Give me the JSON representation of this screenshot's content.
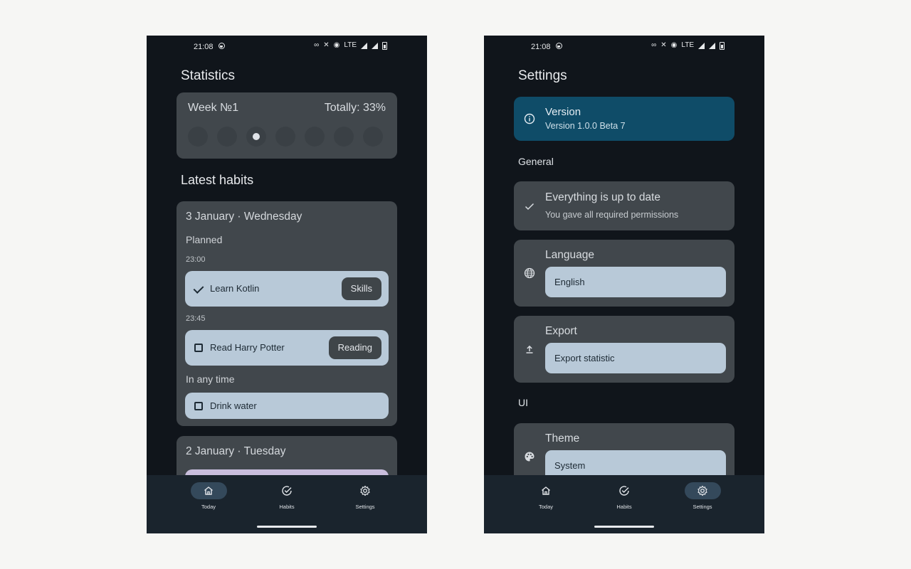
{
  "left": {
    "status": {
      "time": "21:08",
      "network": "LTE"
    },
    "title": "Statistics",
    "stats": {
      "week": "Week №1",
      "total": "Totally: 33%",
      "days": 7,
      "active_day_index": 2
    },
    "latest_title": "Latest habits",
    "day1": {
      "title": "3 January · Wednesday",
      "planned_label": "Planned",
      "time1": "23:00",
      "habit1": {
        "name": "Learn Kotlin",
        "tag": "Skills",
        "done": true
      },
      "time2": "23:45",
      "habit2": {
        "name": "Read Harry Potter",
        "tag": "Reading",
        "done": false
      },
      "anytime_label": "In any time",
      "habit3": {
        "name": "Drink water",
        "done": false
      }
    },
    "day2": {
      "title": "2 January · Tuesday"
    },
    "nav": {
      "today": "Today",
      "habits": "Habits",
      "settings": "Settings",
      "active": "today"
    }
  },
  "right": {
    "status": {
      "time": "21:08",
      "network": "LTE"
    },
    "title": "Settings",
    "version": {
      "title": "Version",
      "value": "Version 1.0.0 Beta 7"
    },
    "general_label": "General",
    "uptodate": {
      "title": "Everything is up to date",
      "subtitle": "You gave all required permissions"
    },
    "language": {
      "title": "Language",
      "value": "English"
    },
    "export": {
      "title": "Export",
      "value": "Export statistic"
    },
    "ui_label": "UI",
    "theme": {
      "title": "Theme",
      "value": "System"
    },
    "nav": {
      "today": "Today",
      "habits": "Habits",
      "settings": "Settings",
      "active": "settings"
    }
  },
  "colors": {
    "background": "#10151b",
    "card": "#41474c",
    "accent_card": "#0f4c68",
    "habit": "#b8c9d8",
    "navbar": "#1a242d"
  }
}
